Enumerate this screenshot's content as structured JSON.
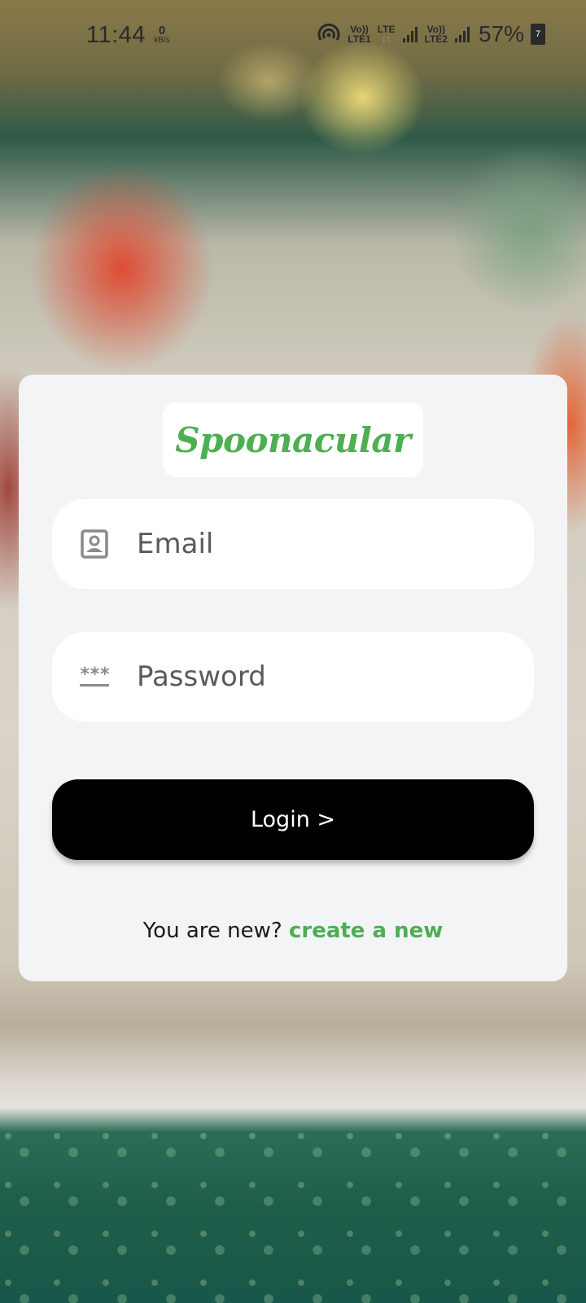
{
  "status_bar": {
    "time": "11:44",
    "speed_value": "0",
    "speed_unit": "kB/s",
    "sim1_top": "Vo))",
    "sim1_bottom": "LTE1",
    "lte_top": "LTE",
    "lte_bottom": "↓↑",
    "sim2_top": "Vo))",
    "sim2_bottom": "LTE2",
    "battery_percent": "57%",
    "battery_icon_text": "7"
  },
  "brand": {
    "name": "Spoonacular",
    "color": "#4caf50"
  },
  "form": {
    "email_placeholder": "Email",
    "password_placeholder": "Password",
    "password_icon_text": "***",
    "login_label": "Login >"
  },
  "signup": {
    "prompt": "You are new? ",
    "link_text": "create a new"
  }
}
